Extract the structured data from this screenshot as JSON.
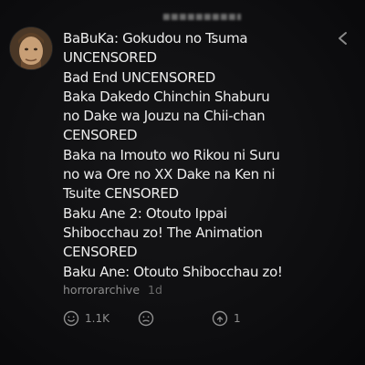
{
  "comment": {
    "lines": [
      "BaBuKa: Gokudou no Tsuma",
      "UNCENSORED",
      "Bad End UNCENSORED",
      "Baka Dakedo Chinchin Shaburu",
      "no Dake wa Jouzu na Chii-chan",
      "CENSORED",
      "Baka na Imouto wo Rikou ni Suru",
      "no wa Ore no XX Dake na Ken ni",
      "Tsuite CENSORED",
      "Baku Ane 2: Otouto Ippai",
      "Shibocchau zo! The Animation",
      "CENSORED",
      "Baku Ane: Otouto Shibocchau zo!"
    ]
  },
  "author": {
    "username": "horrorarchive",
    "time": "1d",
    "avatar_icon": "user-avatar"
  },
  "actions": {
    "like_icon": "smile-icon",
    "like_count": "1.1K",
    "dislike_icon": "neutral-face-icon",
    "reply_icon": "reply-icon",
    "reply_count": "1"
  },
  "header": {
    "share_icon": "share-icon"
  }
}
